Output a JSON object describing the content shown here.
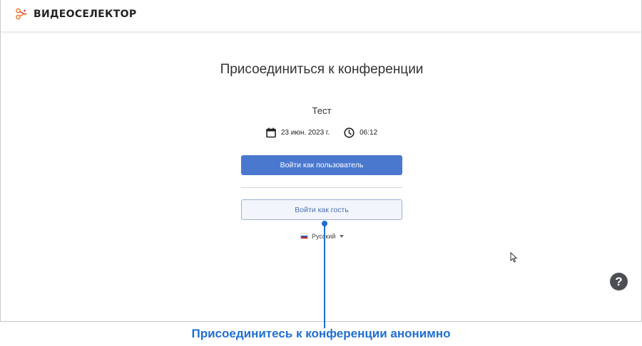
{
  "app": {
    "logo_text": "ВИДЕОСЕЛЕКТОР"
  },
  "conference": {
    "title": "Присоединиться к конференции",
    "name": "Тест",
    "date": "23 июн. 2023 г.",
    "time": "06:12"
  },
  "actions": {
    "login_user_label": "Войти как пользователь",
    "login_guest_label": "Войти как гость"
  },
  "language": {
    "selected": "Русский",
    "flag_icon": "russian-flag-icon"
  },
  "help": {
    "label": "?"
  },
  "callout": {
    "text": "Присоединитесь к конференции анонимно"
  },
  "colors": {
    "accent": "#4a78cf",
    "guest_bg": "#f2f5fb",
    "callout": "#1f6fd0",
    "help_bg": "#4b4f54",
    "logo_orange": "#f07a2a",
    "logo_red": "#d8403a"
  }
}
